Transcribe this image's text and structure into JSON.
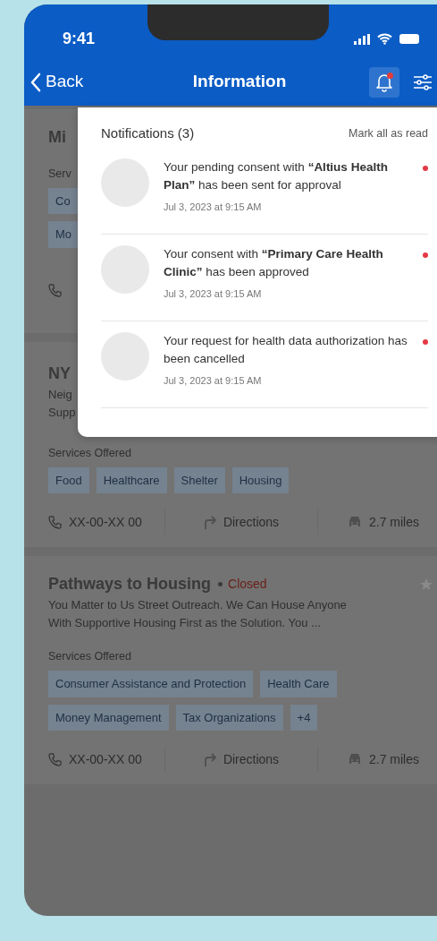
{
  "status_bar": {
    "time": "9:41"
  },
  "nav": {
    "back": "Back",
    "title": "Information",
    "bell_selected": true,
    "bell_unread": true
  },
  "cards": [
    {
      "kind": "covered",
      "title": "Mi",
      "services_label": "Serv",
      "tag_rows": [
        [
          "Co"
        ],
        [
          "Mo"
        ]
      ]
    },
    {
      "kind": "full",
      "title": "NY",
      "description": [
        "Neig",
        "Supp"
      ],
      "services_label": "Services Offered",
      "tag_rows": [
        [
          "Food",
          "Healthcare",
          "Shelter",
          "Housing"
        ]
      ],
      "footer": {
        "phone": "XX-00-XX 00",
        "directions": "Directions",
        "distance": "2.7 miles"
      }
    },
    {
      "kind": "full",
      "title": "Pathways to Housing",
      "status": "Closed",
      "description": [
        "You Matter to Us Street Outreach. We Can House Anyone",
        "With Supportive Housing First as the Solution. You ..."
      ],
      "services_label": "Services Offered",
      "tag_rows": [
        [
          "Consumer Assistance and Protection",
          "Health Care"
        ],
        [
          "Money Management",
          "Tax Organizations",
          "+4"
        ]
      ],
      "footer": {
        "phone": "XX-00-XX 00",
        "directions": "Directions",
        "distance": "2.7 miles"
      }
    }
  ],
  "notifications": {
    "title": "Notifications (3)",
    "mark_all": "Mark all as read",
    "items": [
      {
        "message": "Your pending consent with **“Altius Health Plan”** has been sent for approval",
        "time": "Jul 3, 2023 at 9:15 AM",
        "unread": true
      },
      {
        "message": "Your consent with **“Primary Care Health Clinic”** has been approved",
        "time": "Jul 3, 2023 at 9:15 AM",
        "unread": true
      },
      {
        "message": "Your request for health data authorization has been cancelled",
        "time": "Jul 3, 2023 at 9:15 AM",
        "unread": true
      }
    ]
  }
}
